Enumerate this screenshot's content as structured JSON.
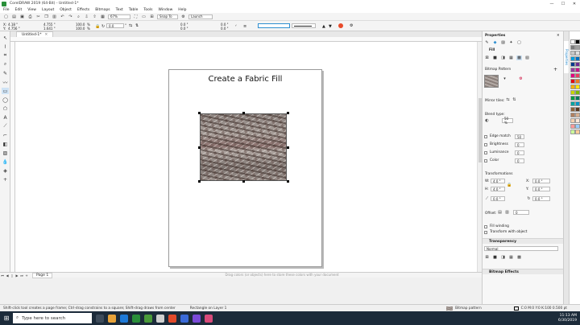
{
  "window": {
    "title": "CorelDRAW 2019 (64-Bit) - Untitled-1*"
  },
  "menu": [
    "File",
    "Edit",
    "View",
    "Layout",
    "Object",
    "Effects",
    "Bitmaps",
    "Text",
    "Table",
    "Tools",
    "Window",
    "Help"
  ],
  "toolbar": {
    "zoom": "67%",
    "snap_to": "Snap To",
    "launch": "Launch"
  },
  "propbar": {
    "x": "4.18 \"",
    "y": "4.756 \"",
    "w": "4.755 \"",
    "h": "1.641 \"",
    "sx": "100.0",
    "sy": "100.0",
    "pct": "%",
    "angle": "0.0",
    "rot_unit": "°",
    "pos1": "0.0 \"",
    "pos2": "0.0 \"",
    "pos3": "0.0 \"",
    "pos4": "0.0 \"",
    "outline": ""
  },
  "document": {
    "tab": "Untitled-1*",
    "page_title": "Create a Fabric Fill"
  },
  "page_nav": {
    "page": "Page 1"
  },
  "hint": "Drag colors (or objects) here to store these colors with your document",
  "status": {
    "left": "Shift-click tool creates a page frame; Ctrl-drag constrains to a square; Shift-drag draws from center",
    "object": "Rectangle on Layer 1",
    "fill_label": "Bitmap pattern",
    "outline": "C:0 M:0 Y:0 K:100 0.500 pt"
  },
  "docker": {
    "title": "Properties",
    "fill_label": "Fill",
    "bitmap_pattern": "Bitmap Pattern",
    "mirror_tiles": "Mirror tiles:",
    "blend_type": "Blend type:",
    "blend_val": "50 %",
    "edge_match": "Edge match",
    "edge_val": "50",
    "brightness": "Brightness",
    "brightness_val": "0",
    "luminance": "Luminance",
    "luminance_val": "0",
    "color": "Color",
    "color_val": "0",
    "transformations": "Transformations",
    "w": "4.0 \"",
    "h": "4.0 \"",
    "x": "0.0 \"",
    "y": "0.0 \"",
    "angle": "0.0 °",
    "angle2": "0.0 °",
    "offset": "Offset:",
    "offset_val": "0",
    "fill_winding": "Fill winding",
    "transform_with_object": "Transform with object",
    "transparency": "Transparency",
    "merge_mode": "Normal",
    "bitmap_effects": "Bitmap Effects"
  },
  "taskbar": {
    "search": "Type here to search",
    "time": "11:13 AM",
    "date": "6/30/2019"
  },
  "palette_colors": [
    "#ffffff",
    "#000000",
    "#7a7a7a",
    "#a0a0a0",
    "#c8c8c8",
    "#e0e0e0",
    "#00a0e0",
    "#0070c0",
    "#003a8c",
    "#6a2c91",
    "#9a3ba0",
    "#c8148c",
    "#e6007e",
    "#e84060",
    "#e30613",
    "#f07820",
    "#f9b000",
    "#ffe600",
    "#c8d400",
    "#7ab800",
    "#009a44",
    "#007a5e",
    "#00a5a0",
    "#0096c8",
    "#8c6239",
    "#5a3a22",
    "#b08060",
    "#d8b090",
    "#f4d0b0",
    "#fde8d8",
    "#ff9999",
    "#99ccff",
    "#ccff99",
    "#ffcc99"
  ],
  "colors": {
    "accent": "#2f8fd0",
    "taskbar": "#1c2b3a"
  }
}
